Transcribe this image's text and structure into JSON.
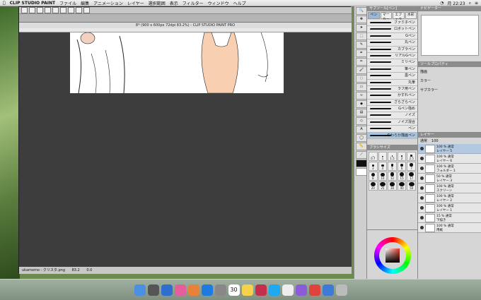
{
  "menubar": {
    "apple": "",
    "app_name": "CLIP STUDIO PAINT",
    "items": [
      "ファイル",
      "編集",
      "アニメーション",
      "レイヤー",
      "選択範囲",
      "表示",
      "フィルター",
      "ウィンドウ",
      "ヘルプ"
    ],
    "clock": "月 22:23"
  },
  "window": {
    "doc_title": "8* (900 x 600px 72dpi 83.2%) - CLIP STUDIO PAINT PRO",
    "status": {
      "zoom": "83.2",
      "coords": "0.0",
      "file": "ukamomo - クリスタ.png"
    }
  },
  "subtool_panel": {
    "header": "サブツール[ペン]",
    "tabs": [
      "ペン",
      "マーカー",
      "エフェクト",
      "水彩"
    ],
    "brushes": [
      {
        "label": "ファミ子ペン"
      },
      {
        "label": "ロボットペン"
      },
      {
        "label": "Gペン"
      },
      {
        "label": "丸ペン"
      },
      {
        "label": "カブラペン"
      },
      {
        "label": "リアルGペン"
      },
      {
        "label": "ミリペン"
      },
      {
        "label": "筆ペン"
      },
      {
        "label": "墨ペン"
      },
      {
        "label": "丸筆"
      },
      {
        "label": "ラフ用ペン"
      },
      {
        "label": "かすれペン"
      },
      {
        "label": "ざらざらペン"
      },
      {
        "label": "Gペン強め"
      },
      {
        "label": "ノイズ"
      },
      {
        "label": "ノイズ混合"
      },
      {
        "label": "ペン"
      },
      {
        "label": "やわらか描画ペン"
      }
    ]
  },
  "brush_size_panel": {
    "header": "ブラシサイズ",
    "sizes": [
      "0.7",
      "1",
      "1.5",
      "2",
      "2.5",
      "3",
      "4",
      "5",
      "6",
      "7",
      "8",
      "10",
      "12",
      "15",
      "17",
      "20",
      "25",
      "30",
      "40",
      "50"
    ]
  },
  "layer_panel": {
    "header": "レイヤー",
    "blend": "通常",
    "opacity": "100",
    "layers": [
      {
        "opacity": "100 %",
        "blend": "通常",
        "name": "レイヤー 5"
      },
      {
        "opacity": "100 %",
        "blend": "通常",
        "name": "レイヤー 6"
      },
      {
        "opacity": "100 %",
        "blend": "通常",
        "name": "フォルダー 1"
      },
      {
        "opacity": "50 %",
        "blend": "通常",
        "name": "レイヤー 3"
      },
      {
        "opacity": "100 %",
        "blend": "通常",
        "name": "スクリーン"
      },
      {
        "opacity": "100 %",
        "blend": "通常",
        "name": "レイヤー 2"
      },
      {
        "opacity": "100 %",
        "blend": "通常",
        "name": "レイヤー 1"
      },
      {
        "opacity": "15 %",
        "blend": "通常",
        "name": "下描き"
      },
      {
        "opacity": "100 %",
        "blend": "通常",
        "name": "用紙"
      }
    ]
  },
  "props_panel": {
    "header": "ツールプロパティ",
    "label_blend": "描画",
    "label_color": "カラー",
    "label_sub": "サブカラー"
  },
  "navigator_header": "ナビゲーター",
  "colors": {
    "accent": "#a9c4df",
    "panel": "#d6d6d6",
    "canvas": "#3d3d3d",
    "skin": "#f8cfb0"
  },
  "dock": {
    "date": "30"
  }
}
